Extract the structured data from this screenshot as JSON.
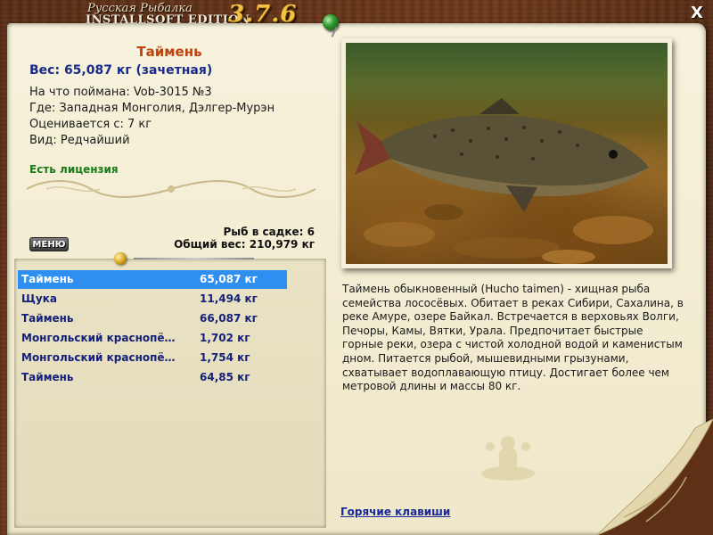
{
  "window": {
    "title_ru": "Русская Рыбалка",
    "title_en": "INSTALLSOFT EDITION",
    "version": "3.7.6",
    "close_label": "X"
  },
  "catch": {
    "fish_name": "Таймень",
    "weight_text": "Вес: 65,087 кг (зачетная)",
    "details": [
      "На что поймана: Vob-3015 №3",
      "Где: Западная Монголия, Дэлгер-Мурэн",
      "Оценивается с: 7 кг",
      "Вид: Редчайший"
    ],
    "license": "Есть лицензия"
  },
  "cage": {
    "count_text": "Рыб в садке: 6",
    "total_text": "Общий вес: 210,979 кг"
  },
  "menu_label": "МЕНЮ",
  "list": {
    "selected_index": 0,
    "rows": [
      {
        "name": "Таймень",
        "weight": "65,087 кг"
      },
      {
        "name": "Щука",
        "weight": "11,494 кг"
      },
      {
        "name": "Таймень",
        "weight": "66,087 кг"
      },
      {
        "name": "Монгольский краснопё…",
        "weight": "1,702 кг"
      },
      {
        "name": "Монгольский краснопё…",
        "weight": "1,754 кг"
      },
      {
        "name": "Таймень",
        "weight": "64,85 кг"
      }
    ]
  },
  "description": "Таймень обыкновенный (Hucho taimen) - хищная рыба семейства лососёвых. Обитает в реках Сибири, Сахалина, в реке Амуре, озере Байкал. Встречается в верховьях Волги, Печоры, Камы, Вятки, Урала. Предпочитает быстрые горные реки, озера с чистой холодной водой и каменистым дном. Питается рыбой, мышевидными грызунами, схватывает водоплавающую птицу. Достигает более чем метровой длины и массы 80 кг.",
  "hotkeys_label": "Горячие клавиши",
  "colors": {
    "accent_name": "#c0430e",
    "weight_blue": "#1a2a8a",
    "license_green": "#1a7a1a",
    "selection_blue": "#2f8ff0",
    "version_gold": "#f3c340"
  },
  "icons": {
    "pin": "green-pin-icon",
    "hook": "fishing-hook-icon",
    "close": "close-icon",
    "fisher": "fisherman-silhouette-icon"
  }
}
